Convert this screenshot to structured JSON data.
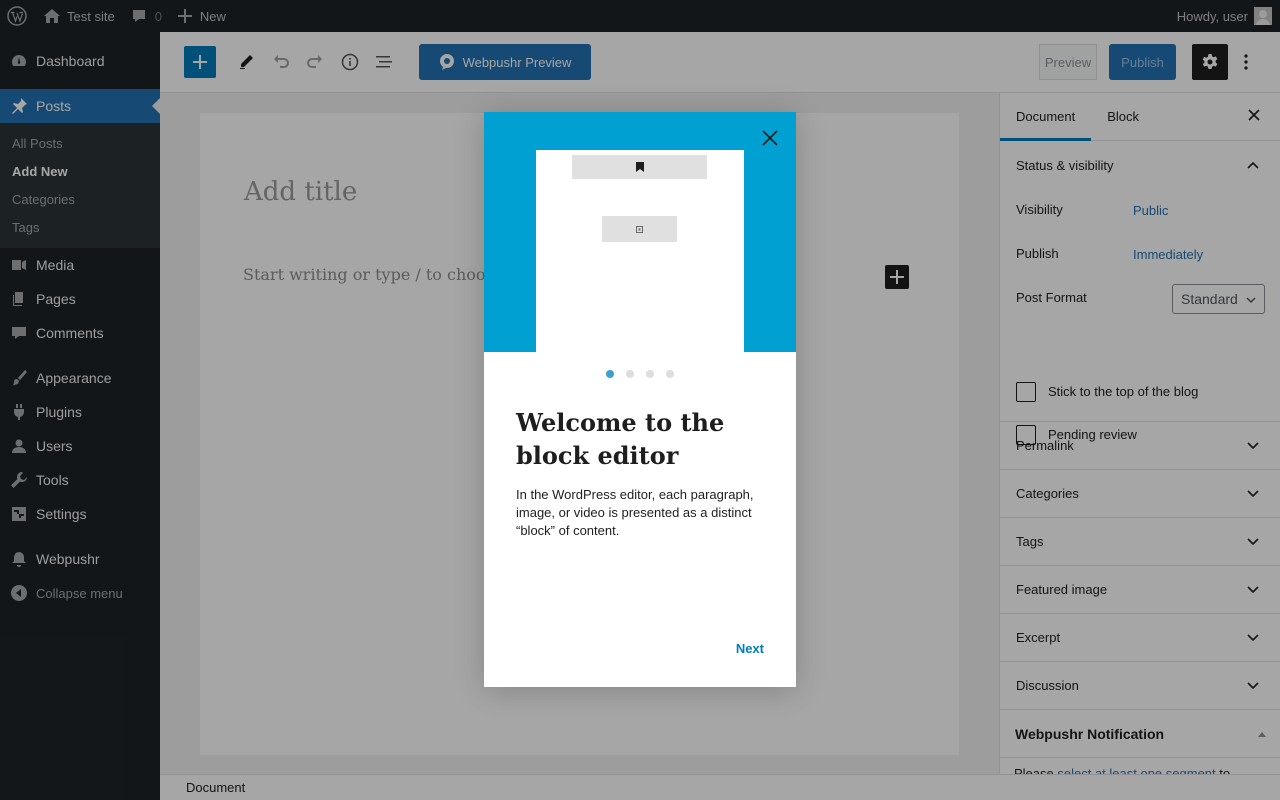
{
  "admin_bar": {
    "site_name": "Test site",
    "comments_count": "0",
    "new_label": "New",
    "greeting": "Howdy, user"
  },
  "admin_menu": {
    "dashboard": "Dashboard",
    "posts": "Posts",
    "posts_submenu": [
      "All Posts",
      "Add New",
      "Categories",
      "Tags"
    ],
    "media": "Media",
    "pages": "Pages",
    "comments": "Comments",
    "appearance": "Appearance",
    "plugins": "Plugins",
    "users": "Users",
    "tools": "Tools",
    "settings": "Settings",
    "webpushr": "Webpushr",
    "collapse": "Collapse menu"
  },
  "toolbar": {
    "webpushr_preview": "Webpushr Preview",
    "preview": "Preview",
    "publish": "Publish"
  },
  "editor": {
    "title_placeholder": "Add title",
    "body_placeholder": "Start writing or type / to choose a"
  },
  "footer": {
    "breadcrumb": "Document"
  },
  "sidebar": {
    "tabs": [
      "Document",
      "Block"
    ],
    "status_visibility": "Status & visibility",
    "visibility_label": "Visibility",
    "visibility_value": "Public",
    "publish_label": "Publish",
    "publish_value": "Immediately",
    "post_format_label": "Post Format",
    "post_format_value": "Standard",
    "stick_to_top": "Stick to the top of the blog",
    "pending_review": "Pending review",
    "panels": [
      "Permalink",
      "Categories",
      "Tags",
      "Featured image",
      "Excerpt",
      "Discussion"
    ],
    "webpushr_panel": "Webpushr Notification",
    "webpushr_note_prefix": "Please",
    "webpushr_note_link": "select at least one segment",
    "webpushr_note_suffix": "to"
  },
  "welcome_guide": {
    "title": "Welcome to the block editor",
    "text": "In the WordPress editor, each paragraph, image, or video is presented as a distinct “block” of content.",
    "next": "Next",
    "page_count": 4,
    "current_page": 1,
    "hero_color": "#00a0d2"
  },
  "colors": {
    "accent": "#007cba",
    "admin_dark": "#1d2327",
    "wp_blue": "#2271b1"
  }
}
